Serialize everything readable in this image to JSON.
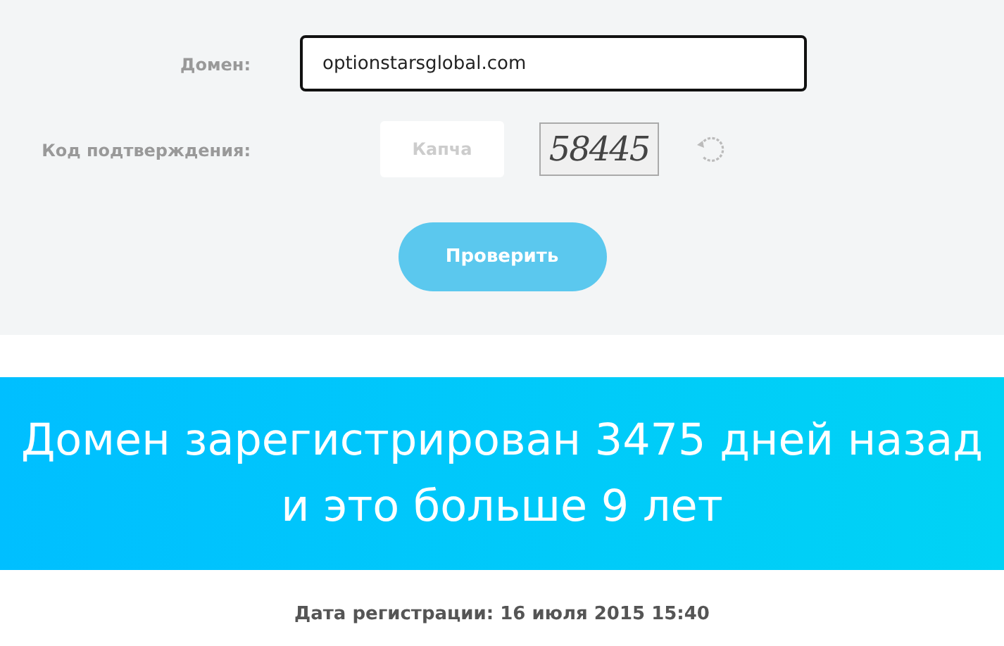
{
  "form": {
    "domain_label": "Домен:",
    "domain_value": "optionstarsglobal.com",
    "captcha_label": "Код подтверждения:",
    "captcha_placeholder": "Капча",
    "captcha_code": "58445",
    "submit": "Проверить"
  },
  "result": {
    "headline": "Домен зарегистрирован 3475 дней назад и это больше 9 лет",
    "registration_date": "Дата регистрации: 16 июля 2015 15:40"
  }
}
